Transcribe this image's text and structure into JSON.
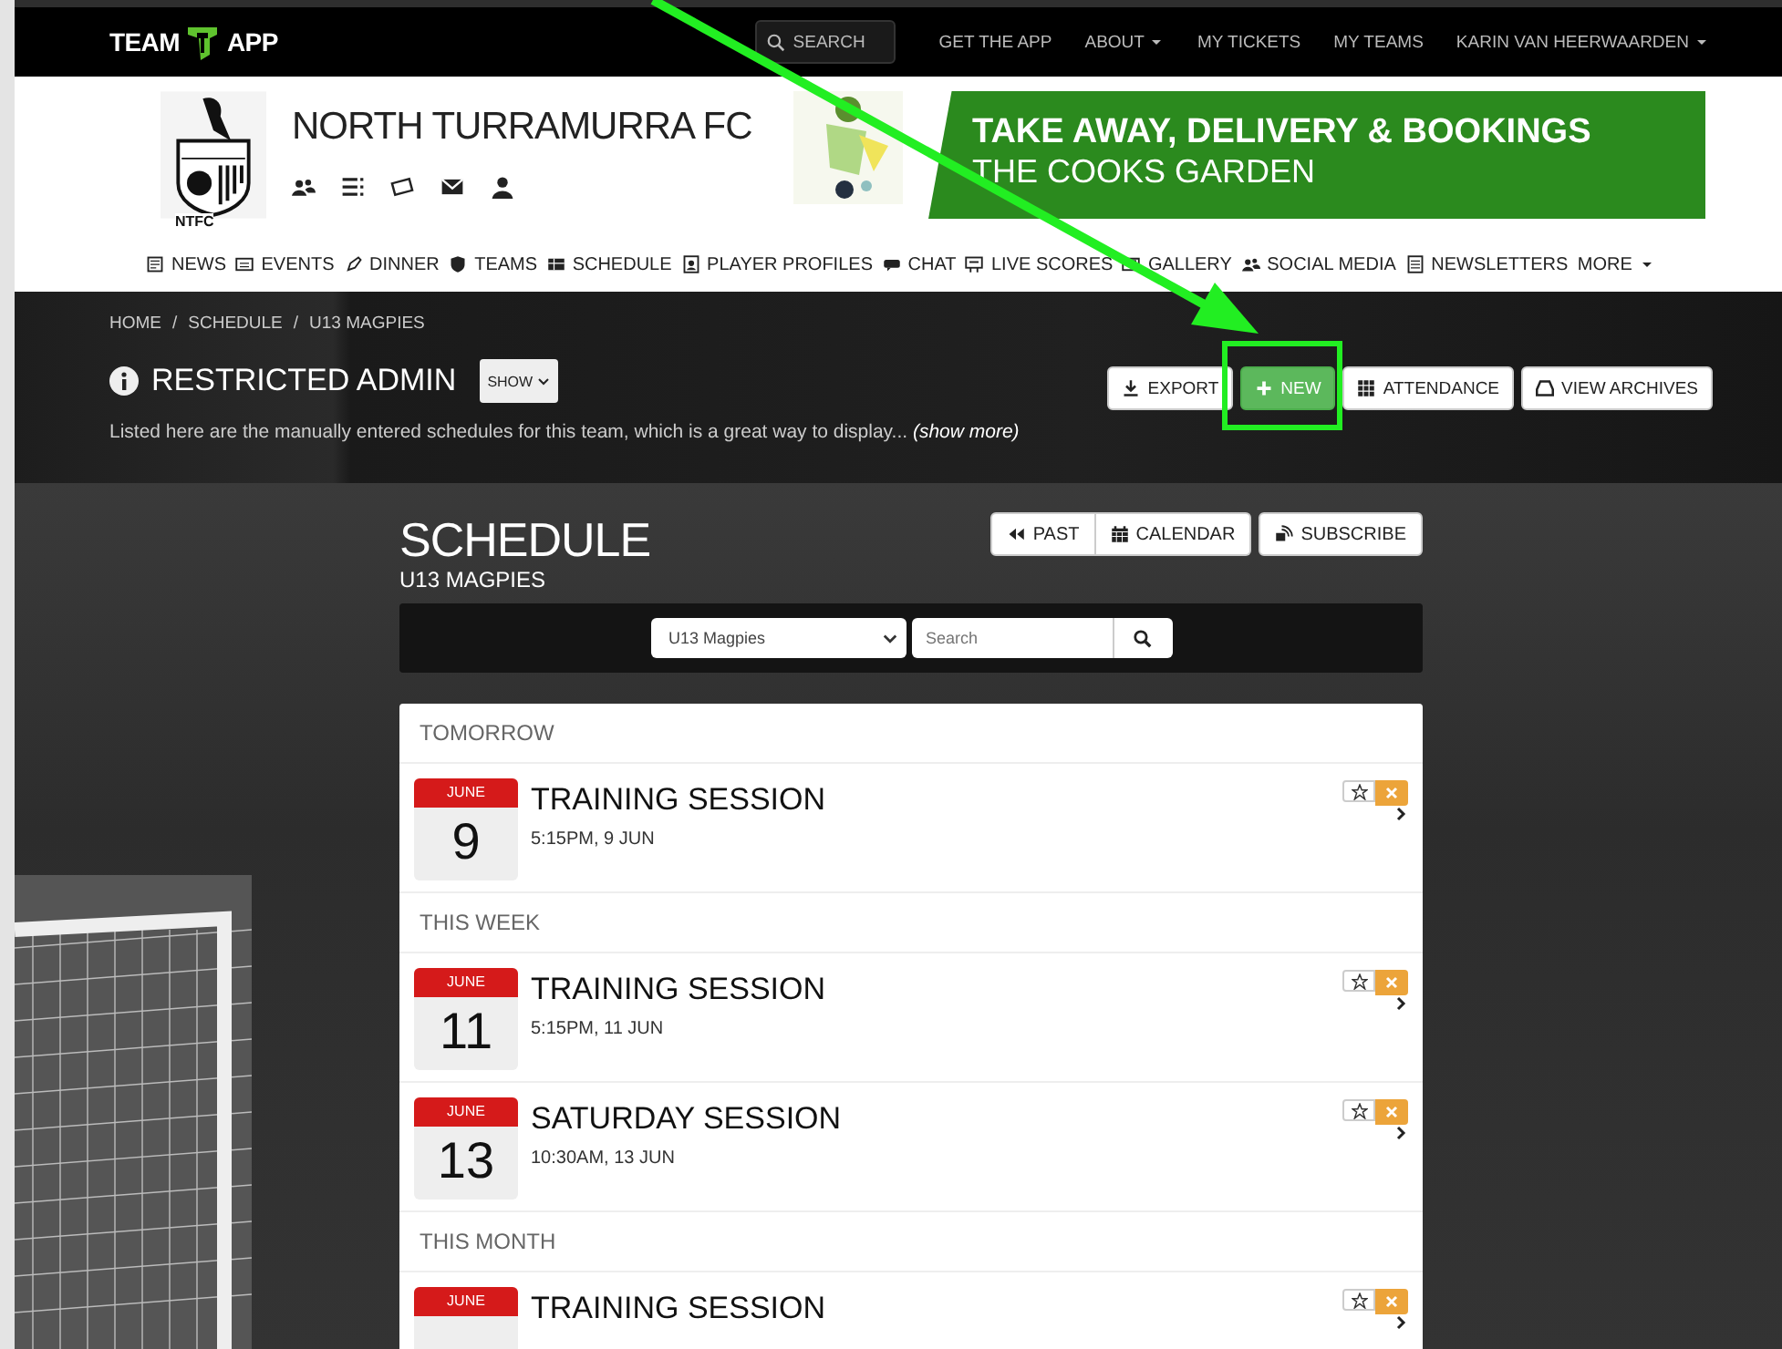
{
  "topbar": {
    "logo": {
      "left": "TEAM",
      "right": "APP"
    },
    "search": {
      "placeholder": "SEARCH"
    },
    "links": [
      {
        "label": "GET THE APP",
        "dropdown": false
      },
      {
        "label": "ABOUT",
        "dropdown": true
      },
      {
        "label": "MY TICKETS",
        "dropdown": false
      },
      {
        "label": "MY TEAMS",
        "dropdown": false
      },
      {
        "label": "KARIN VAN HEERWAARDEN",
        "dropdown": true
      }
    ]
  },
  "club": {
    "crest_text": "NTFC",
    "name": "NORTH TURRAMURRA FC"
  },
  "ad": {
    "headline": "TAKE AWAY, DELIVERY & BOOKINGS",
    "subline": "THE COOKS GARDEN"
  },
  "nav": [
    {
      "label": "NEWS",
      "dropdown": false
    },
    {
      "label": "EVENTS",
      "dropdown": false
    },
    {
      "label": "DINNER",
      "dropdown": false
    },
    {
      "label": "TEAMS",
      "dropdown": false
    },
    {
      "label": "SCHEDULE",
      "dropdown": false
    },
    {
      "label": "PLAYER PROFILES",
      "dropdown": false
    },
    {
      "label": "CHAT",
      "dropdown": false
    },
    {
      "label": "LIVE SCORES",
      "dropdown": false
    },
    {
      "label": "GALLERY",
      "dropdown": false
    },
    {
      "label": "SOCIAL MEDIA",
      "dropdown": false
    },
    {
      "label": "NEWSLETTERS",
      "dropdown": false
    },
    {
      "label": "MORE",
      "dropdown": true
    }
  ],
  "breadcrumb": {
    "separator": "/",
    "items": [
      "HOME",
      "SCHEDULE",
      "U13 MAGPIES"
    ]
  },
  "admin": {
    "title": "RESTRICTED ADMIN",
    "toggle": "SHOW",
    "description": "Listed here are the manually entered schedules for this team, which is a great way to display...",
    "more": "(show more)"
  },
  "admin_actions": [
    {
      "label": "EXPORT",
      "kind": "export"
    },
    {
      "label": "NEW",
      "kind": "new"
    },
    {
      "label": "ATTENDANCE",
      "kind": "attendance"
    },
    {
      "label": "VIEW ARCHIVES",
      "kind": "archives"
    }
  ],
  "schedule": {
    "title": "SCHEDULE",
    "subtitle": "U13 MAGPIES",
    "views": [
      {
        "label": "PAST",
        "kind": "past"
      },
      {
        "label": "CALENDAR",
        "kind": "calendar"
      }
    ],
    "subscribe": "SUBSCRIBE",
    "team_select": {
      "value": "U13 Magpies"
    },
    "search": {
      "placeholder": "Search"
    },
    "groups": [
      {
        "heading": "TOMORROW",
        "events": [
          {
            "month": "JUNE",
            "day": "9",
            "title": "TRAINING SESSION",
            "time": "5:15PM, 9 JUN"
          }
        ]
      },
      {
        "heading": "THIS WEEK",
        "events": [
          {
            "month": "JUNE",
            "day": "11",
            "title": "TRAINING SESSION",
            "time": "5:15PM, 11 JUN"
          },
          {
            "month": "JUNE",
            "day": "13",
            "title": "SATURDAY SESSION",
            "time": "10:30AM, 13 JUN"
          }
        ]
      },
      {
        "heading": "THIS MONTH",
        "events": [
          {
            "month": "JUNE",
            "title": "TRAINING SESSION"
          }
        ]
      }
    ]
  }
}
